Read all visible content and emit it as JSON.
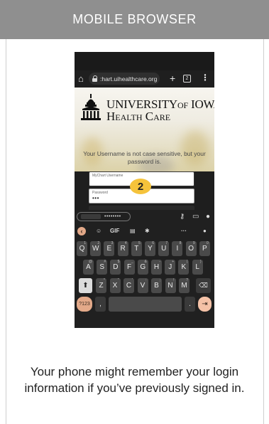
{
  "header": {
    "title": "MOBILE BROWSER"
  },
  "browser": {
    "url": ":hart.uihealthcare.org",
    "tab_count": "2"
  },
  "webpage": {
    "logo_line1_big": "UNIVERSITY",
    "logo_line1_small": "OF",
    "logo_line1_big2": "IOWA",
    "logo_line2_big": "H",
    "logo_line2_small": "EALTH",
    "logo_line2_big2": "C",
    "logo_line2_small2": "ARE",
    "username_note": "Your Username is not case sensitive, but your password is.",
    "username_label": "MyChart Username",
    "password_label": "Password",
    "password_value": "•••"
  },
  "step_number": "2",
  "keyboard": {
    "autofill_dots": "••••••••",
    "toolbar_gif": "GIF",
    "toolbar_more": "···",
    "row1": [
      {
        "k": "Q",
        "s": "1"
      },
      {
        "k": "W",
        "s": "2"
      },
      {
        "k": "E",
        "s": "3"
      },
      {
        "k": "R",
        "s": "4"
      },
      {
        "k": "T",
        "s": "5"
      },
      {
        "k": "Y",
        "s": "6"
      },
      {
        "k": "U",
        "s": "7"
      },
      {
        "k": "I",
        "s": "8"
      },
      {
        "k": "O",
        "s": "9"
      },
      {
        "k": "P",
        "s": "0"
      }
    ],
    "row2": [
      {
        "k": "A",
        "s": "@"
      },
      {
        "k": "S",
        "s": "#"
      },
      {
        "k": "D",
        "s": "$"
      },
      {
        "k": "F",
        "s": "_"
      },
      {
        "k": "G",
        "s": "&"
      },
      {
        "k": "H",
        "s": "-"
      },
      {
        "k": "J",
        "s": "+"
      },
      {
        "k": "K",
        "s": "("
      },
      {
        "k": "L",
        "s": ")"
      }
    ],
    "row3": [
      {
        "k": "Z",
        "s": "*"
      },
      {
        "k": "X",
        "s": "\""
      },
      {
        "k": "C",
        "s": "'"
      },
      {
        "k": "V",
        "s": ":"
      },
      {
        "k": "B",
        "s": ";"
      },
      {
        "k": "N",
        "s": "!"
      },
      {
        "k": "M",
        "s": "?"
      }
    ],
    "num_key": "?123",
    "comma_key": ",",
    "period_key": "."
  },
  "caption": "Your phone might remember your login information if you’ve previously signed in.",
  "colors": {
    "header_bg": "#8f8f8f",
    "badge": "#f5c33b",
    "accent_key": "#e3a989"
  }
}
